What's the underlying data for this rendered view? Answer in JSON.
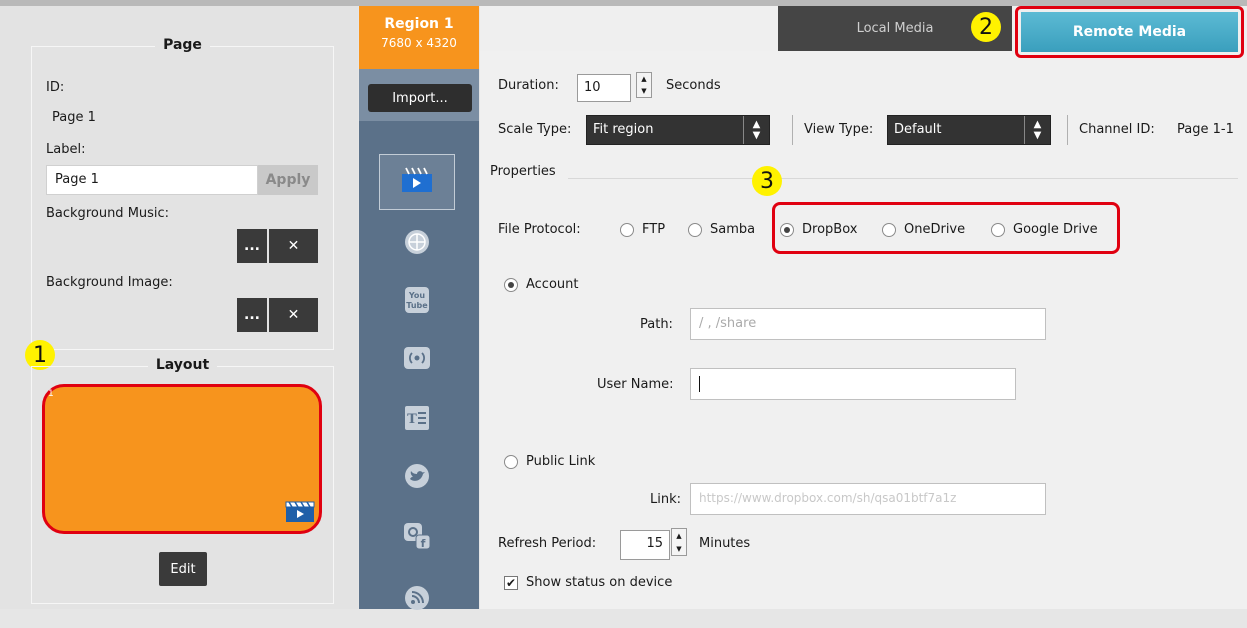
{
  "left": {
    "page_title": "Page",
    "id_label": "ID:",
    "id_value": "Page 1",
    "label_label": "Label:",
    "label_value": "Page 1",
    "apply": "Apply",
    "bg_music": "Background Music:",
    "bg_image": "Background Image:",
    "browse": "...",
    "clear": "✕",
    "layout_title": "Layout",
    "layout_region_num": "1",
    "edit": "Edit"
  },
  "mid": {
    "region_name": "Region 1",
    "region_size": "7680 x 4320",
    "import": "Import...",
    "tools": [
      "video-icon",
      "web-icon",
      "youtube-icon",
      "stream-icon",
      "text-icon",
      "twitter-icon",
      "instagram-facebook-icon",
      "rss-icon"
    ]
  },
  "tabs": {
    "local": "Local Media",
    "remote": "Remote Media"
  },
  "badges": {
    "one": "1",
    "two": "2",
    "three": "3"
  },
  "form": {
    "duration_label": "Duration:",
    "duration_value": "10",
    "duration_unit": "Seconds",
    "scale_label": "Scale Type:",
    "scale_value": "Fit region",
    "view_label": "View Type:",
    "view_value": "Default",
    "channel_label": "Channel ID:",
    "channel_value": "Page 1-1",
    "properties": "Properties",
    "protocol_label": "File Protocol:",
    "protocols": [
      "FTP",
      "Samba",
      "DropBox",
      "OneDrive",
      "Google Drive"
    ],
    "selected_protocol": "DropBox",
    "account": "Account",
    "path_label": "Path:",
    "path_placeholder": "/ , /share",
    "user_label": "User Name:",
    "public_link": "Public Link",
    "link_label": "Link:",
    "link_placeholder": "https://www.dropbox.com/sh/qsa01btf7a1z",
    "refresh_label": "Refresh Period:",
    "refresh_value": "15",
    "refresh_unit": "Minutes",
    "show_status": "Show status on device"
  },
  "colors": {
    "accent_orange": "#f7941d",
    "highlight_red": "#e00010",
    "tab_blue": "#3a9fbd",
    "toolbar": "#5b7189"
  }
}
